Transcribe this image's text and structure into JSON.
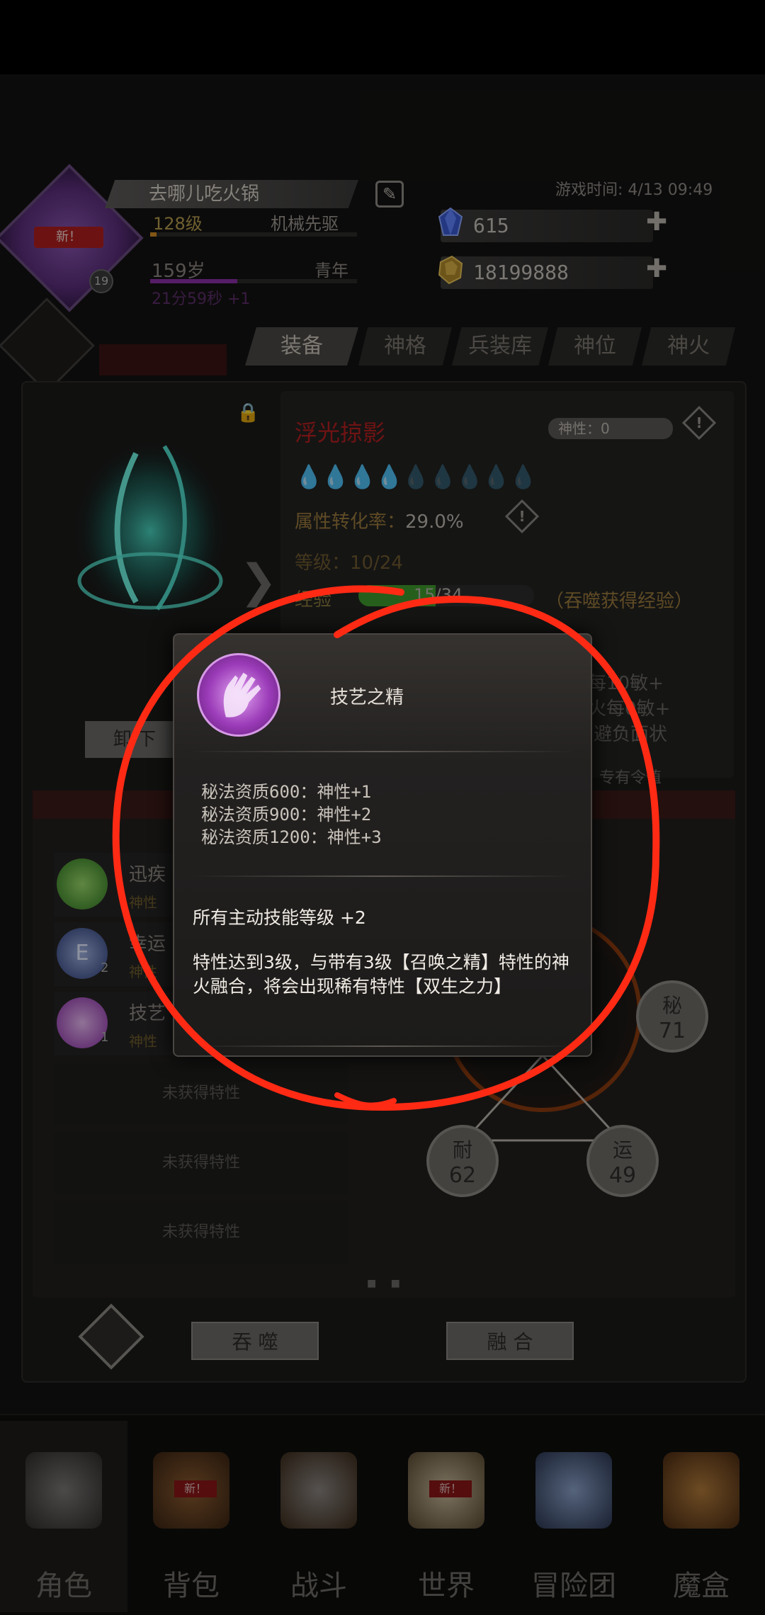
{
  "header": {
    "player_name": "去哪儿吃火锅",
    "avatar_badge": "新！",
    "avatar_level_badge": "19",
    "level": "128级",
    "class_name": "机械先驱",
    "age": "159岁",
    "life_stage": "青年",
    "timer": "21分59秒 +1",
    "game_time": "游戏时间: 4/13 09:49"
  },
  "resources": [
    {
      "icon": "blue-crystal-icon",
      "value": "615"
    },
    {
      "icon": "gold-ore-icon",
      "value": "18199888"
    }
  ],
  "tabs": [
    {
      "label": "装备",
      "active": true
    },
    {
      "label": "神格",
      "active": false
    },
    {
      "label": "兵装库",
      "active": false
    },
    {
      "label": "神位",
      "active": false
    },
    {
      "label": "神火",
      "active": false
    }
  ],
  "weapon": {
    "name": "浮光掠影",
    "divinity": "神性：0",
    "drops": "💧💧💧💧💧💧💧💧💧",
    "drops_filled": 4,
    "drops_total": 9,
    "conversion_label": "属性转化率：",
    "conversion_value": "29.0%",
    "grade": "等级：10/24",
    "exp_label": "经验",
    "exp_value": "15/34",
    "exp_fraction": 0.44,
    "exp_hint": "（吞噬获得经验）",
    "unequip": "卸 下",
    "partial_lines": [
      "每1‍0敏+",
      "火每‍0敏+",
      "避负面状",
      "专有令值"
    ]
  },
  "traits": [
    {
      "name": "迅疾",
      "sub": "神性",
      "icon": "green-swirl-icon"
    },
    {
      "name": "幸运",
      "sub": "神性",
      "icon": "blue-star-e-icon",
      "level": "2"
    },
    {
      "name": "技艺",
      "sub": "神性",
      "icon": "purple-hand-icon",
      "level": "1"
    },
    {
      "name": "未获得特性"
    },
    {
      "name": "未获得特性"
    },
    {
      "name": "未获得特性"
    }
  ],
  "pager_dots": "■ ■",
  "radar": {
    "nodes": [
      {
        "attr": "秘",
        "value": "71"
      },
      {
        "attr": "耐",
        "value": "62"
      },
      {
        "attr": "运",
        "value": "49"
      }
    ]
  },
  "actions": {
    "devour": "吞 噬",
    "fuse": "融 合"
  },
  "popup": {
    "title": "技艺之精",
    "lines": [
      "秘法资质600：神性+1",
      "秘法资质900：神性+2",
      "秘法资质1200：神性+3"
    ],
    "effect": "所有主动技能等级 +2",
    "description": "特性达到3级，与带有3级【召唤之精】特性的神火融合，将会出现稀有特性【双生之力】"
  },
  "nav": [
    {
      "label": "角色",
      "icon": "helmet-icon",
      "active": true
    },
    {
      "label": "背包",
      "icon": "backpack-icon",
      "tag": "新！"
    },
    {
      "label": "战斗",
      "icon": "sword-shield-icon"
    },
    {
      "label": "世界",
      "icon": "scroll-map-icon",
      "tag": "新！"
    },
    {
      "label": "冒险团",
      "icon": "castle-icon"
    },
    {
      "label": "魔盒",
      "icon": "magic-box-icon"
    }
  ],
  "colors": {
    "accent_red": "#b51f1f",
    "annotation_red": "#ff2a14",
    "exp_green": "#3e9a2c",
    "age_purple": "#8a2fa6",
    "gold_text": "#9a7a3c"
  }
}
